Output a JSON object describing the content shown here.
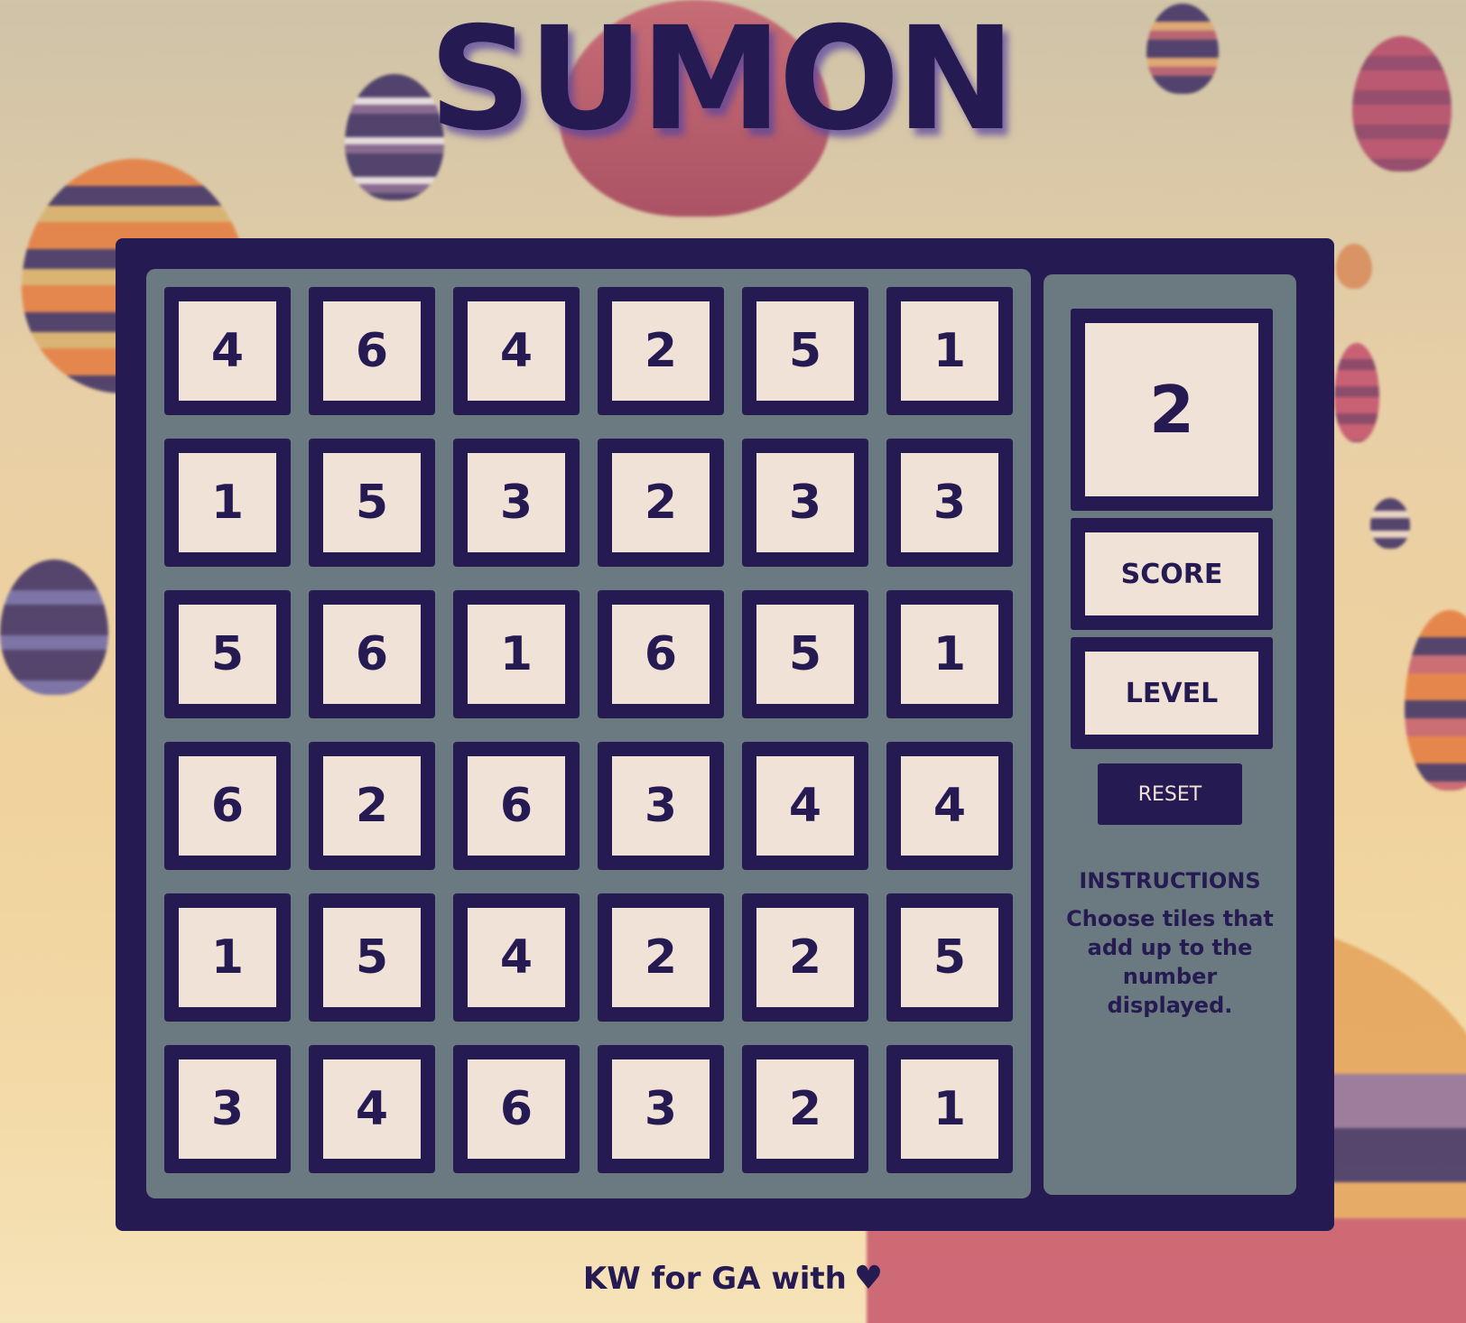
{
  "app": {
    "title": "SUMON"
  },
  "grid": {
    "rows": [
      [
        "4",
        "6",
        "4",
        "2",
        "5",
        "1"
      ],
      [
        "1",
        "5",
        "3",
        "2",
        "3",
        "3"
      ],
      [
        "5",
        "6",
        "1",
        "6",
        "5",
        "1"
      ],
      [
        "6",
        "2",
        "6",
        "3",
        "4",
        "4"
      ],
      [
        "1",
        "5",
        "4",
        "2",
        "2",
        "5"
      ],
      [
        "3",
        "4",
        "6",
        "3",
        "2",
        "1"
      ]
    ]
  },
  "side": {
    "target_number": "2",
    "score_label": "SCORE",
    "level_label": "LEVEL",
    "reset_label": "RESET",
    "instructions_title": "INSTRUCTIONS",
    "instructions_text": "Choose tiles that add up to the number displayed."
  },
  "footer": {
    "credit": "KW for GA with",
    "heart": "♥"
  },
  "colors": {
    "frame": "#251a52",
    "panel": "#6b7a80",
    "tile_face": "#f0e2d6"
  },
  "background": {
    "description_icon": "hot-air-balloons-photo"
  }
}
